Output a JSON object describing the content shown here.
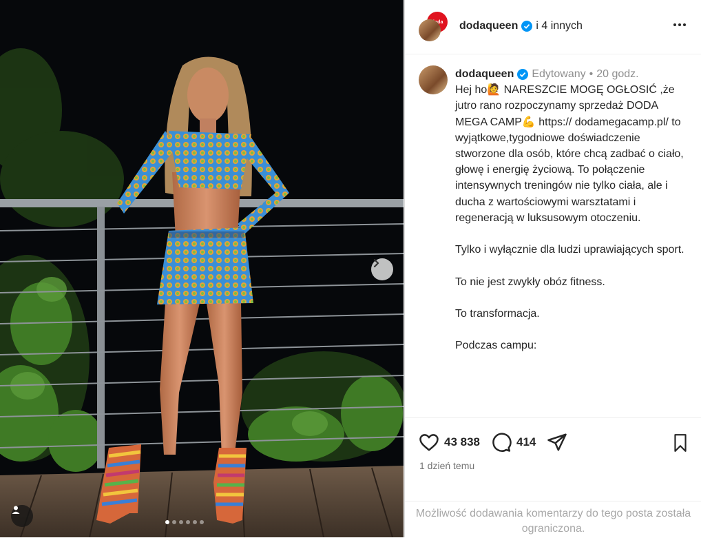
{
  "post": {
    "username": "dodaqueen",
    "coauthors": "i 4 innych",
    "more_icon": "more-horizontal-icon",
    "avatar_badge": "doda"
  },
  "caption": {
    "username": "dodaqueen",
    "edited": "Edytowany",
    "separator": "•",
    "time": "20 godz.",
    "text": "Hej ho🙋 NARESZCIE MOGĘ OGŁOSIĆ ,że jutro rano rozpoczynamy sprzedaż DODA MEGA CAMP💪 https:// dodamegacamp.pl/  to wyjątkowe,tygodniowe  doświadczenie stworzone dla osób, które chcą zadbać o ciało, głowę i energię życiową. To połączenie intensywnych treningów nie tylko ciała, ale i ducha z wartościowymi warsztatami i regeneracją w luksusowym otoczeniu.\n\nTylko i wyłącznie dla ludzi uprawiających sport.\n\nTo nie jest zwykły obóz fitness.\n\nTo transformacja.\n\nPodczas campu:"
  },
  "stats": {
    "likes": "43 838",
    "comments": "414",
    "posted": "1 dzień temu"
  },
  "comments_notice": "Możliwość dodawania komentarzy do tego posta została ograniczona.",
  "carousel": {
    "slides": 6,
    "active_slide": 1,
    "next_icon": "chevron-right-icon",
    "tag_icon": "user-tag-icon"
  },
  "colors": {
    "verified": "#0095f6",
    "muted": "#8e8e8e",
    "badge": "#e0131f"
  }
}
